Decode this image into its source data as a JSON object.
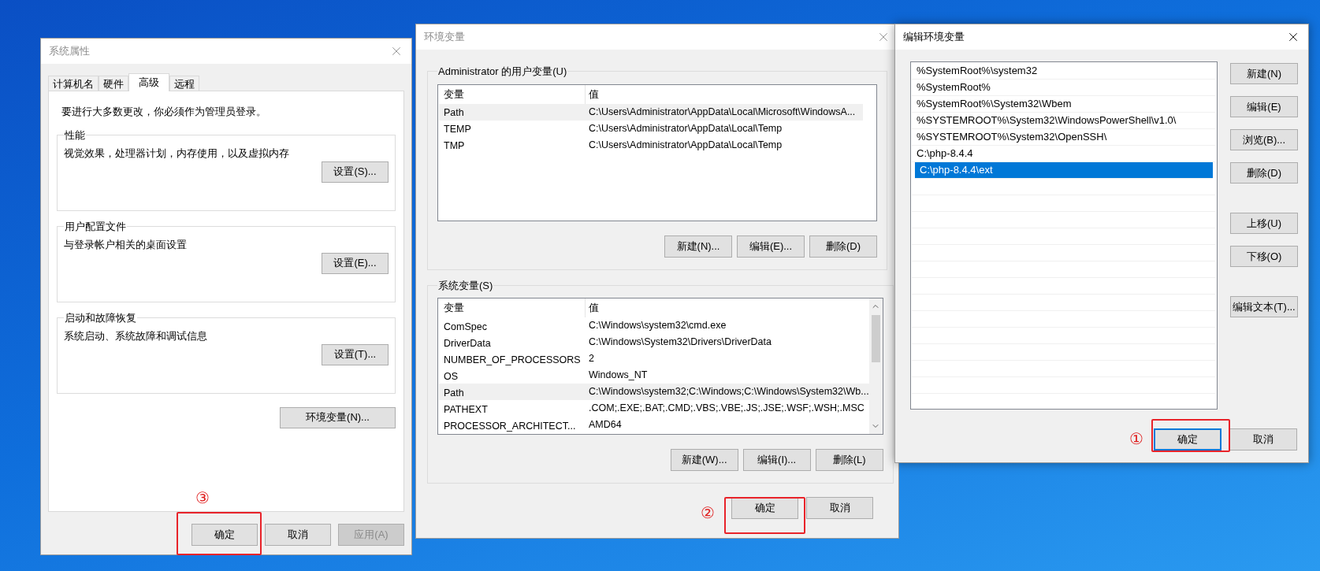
{
  "windows": [
    {
      "kind": "system_properties",
      "title": "系统属性",
      "active": false,
      "tabs": [
        {
          "label": "计算机名",
          "selected": false
        },
        {
          "label": "硬件",
          "selected": false
        },
        {
          "label": "高级",
          "selected": true
        },
        {
          "label": "远程",
          "selected": false
        }
      ],
      "notice": "要进行大多数更改，你必须作为管理员登录。",
      "groups": [
        {
          "title": "性能",
          "description": "视觉效果，处理器计划，内存使用，以及虚拟内存",
          "button": "设置(S)..."
        },
        {
          "title": "用户配置文件",
          "description": "与登录帐户相关的桌面设置",
          "button": "设置(E)..."
        },
        {
          "title": "启动和故障恢复",
          "description": "系统启动、系统故障和调试信息",
          "button": "设置(T)..."
        }
      ],
      "env_button": "环境变量(N)...",
      "buttons": [
        {
          "label": "确定",
          "disabled": false,
          "focused": false
        },
        {
          "label": "取消",
          "disabled": false,
          "focused": false
        },
        {
          "label": "应用(A)",
          "disabled": true,
          "focused": false
        }
      ],
      "annotation": "③"
    },
    {
      "kind": "environment_variables",
      "title": "环境变量",
      "active": false,
      "sections": [
        {
          "title": "Administrator 的用户变量(U)",
          "columns": [
            "变量",
            "值"
          ],
          "scrollbar": false,
          "rows": [
            {
              "name": "Path",
              "value": "C:\\Users\\Administrator\\AppData\\Local\\Microsoft\\WindowsA...",
              "selected": true
            },
            {
              "name": "TEMP",
              "value": "C:\\Users\\Administrator\\AppData\\Local\\Temp",
              "selected": false
            },
            {
              "name": "TMP",
              "value": "C:\\Users\\Administrator\\AppData\\Local\\Temp",
              "selected": false
            }
          ],
          "buttons": [
            "新建(N)...",
            "编辑(E)...",
            "删除(D)"
          ]
        },
        {
          "title": "系统变量(S)",
          "columns": [
            "变量",
            "值"
          ],
          "scrollbar": true,
          "rows": [
            {
              "name": "ComSpec",
              "value": "C:\\Windows\\system32\\cmd.exe",
              "selected": false
            },
            {
              "name": "DriverData",
              "value": "C:\\Windows\\System32\\Drivers\\DriverData",
              "selected": false
            },
            {
              "name": "NUMBER_OF_PROCESSORS",
              "value": "2",
              "selected": false
            },
            {
              "name": "OS",
              "value": "Windows_NT",
              "selected": false
            },
            {
              "name": "Path",
              "value": "C:\\Windows\\system32;C:\\Windows;C:\\Windows\\System32\\Wb...",
              "selected": true
            },
            {
              "name": "PATHEXT",
              "value": ".COM;.EXE;.BAT;.CMD;.VBS;.VBE;.JS;.JSE;.WSF;.WSH;.MSC",
              "selected": false
            },
            {
              "name": "PROCESSOR_ARCHITECT...",
              "value": "AMD64",
              "selected": false
            }
          ],
          "buttons": [
            "新建(W)...",
            "编辑(I)...",
            "删除(L)"
          ]
        }
      ],
      "buttons": [
        {
          "label": "确定",
          "disabled": false,
          "focused": false
        },
        {
          "label": "取消",
          "disabled": false,
          "focused": false
        }
      ],
      "annotation": "②"
    },
    {
      "kind": "edit_variable",
      "title": "编辑环境变量",
      "active": true,
      "items": [
        {
          "text": "%SystemRoot%\\system32",
          "selected": false
        },
        {
          "text": "%SystemRoot%",
          "selected": false
        },
        {
          "text": "%SystemRoot%\\System32\\Wbem",
          "selected": false
        },
        {
          "text": "%SYSTEMROOT%\\System32\\WindowsPowerShell\\v1.0\\",
          "selected": false
        },
        {
          "text": "%SYSTEMROOT%\\System32\\OpenSSH\\",
          "selected": false
        },
        {
          "text": "C:\\php-8.4.4",
          "selected": false
        },
        {
          "text": "C:\\php-8.4.4\\ext",
          "selected": true
        }
      ],
      "side_buttons": [
        {
          "label": "新建(N)",
          "kind": "button"
        },
        {
          "label": "编辑(E)",
          "kind": "button"
        },
        {
          "label": "浏览(B)...",
          "kind": "button"
        },
        {
          "label": "删除(D)",
          "kind": "button"
        },
        {
          "kind": "gap"
        },
        {
          "label": "上移(U)",
          "kind": "button"
        },
        {
          "label": "下移(O)",
          "kind": "button"
        },
        {
          "kind": "gap"
        },
        {
          "label": "编辑文本(T)...",
          "kind": "button"
        }
      ],
      "buttons": [
        {
          "label": "确定",
          "disabled": false,
          "focused": true
        },
        {
          "label": "取消",
          "disabled": false,
          "focused": false
        }
      ],
      "annotation": "①"
    }
  ]
}
